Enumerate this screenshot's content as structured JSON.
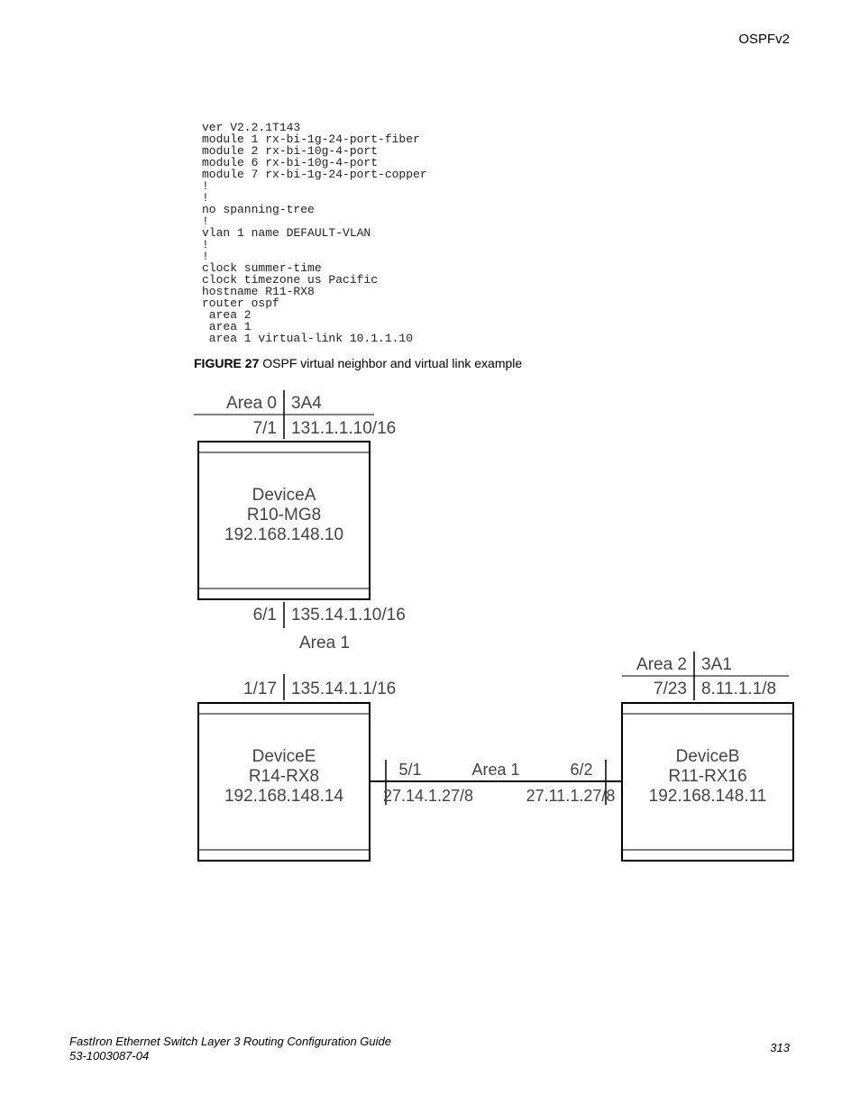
{
  "header": {
    "right": "OSPFv2"
  },
  "code": "ver V2.2.1T143\nmodule 1 rx-bi-1g-24-port-fiber\nmodule 2 rx-bi-10g-4-port\nmodule 6 rx-bi-10g-4-port\nmodule 7 rx-bi-1g-24-port-copper\n!\n!\nno spanning-tree\n!\nvlan 1 name DEFAULT-VLAN\n!\n!\nclock summer-time\nclock timezone us Pacific\nhostname R11-RX8\nrouter ospf\n area 2\n area 1\n area 1 virtual-link 10.1.1.10",
  "figure": {
    "label": "FIGURE 27",
    "caption": "OSPF virtual neighbor and virtual link example"
  },
  "diagram": {
    "deviceA": {
      "top_area": "Area 0",
      "top_id": "3A4",
      "top_port": "7/1",
      "top_ip": "131.1.1.10/16",
      "name_l1": "DeviceA",
      "name_l2": "R10-MG8",
      "name_l3": "192.168.148.10",
      "bot_port": "6/1",
      "bot_ip": "135.14.1.10/16",
      "bot_area": "Area 1"
    },
    "deviceE": {
      "top_port": "1/17",
      "top_ip": "135.14.1.1/16",
      "name_l1": "DeviceE",
      "name_l2": "R14-RX8",
      "name_l3": "192.168.148.14"
    },
    "link": {
      "left_port": "5/1",
      "area": "Area 1",
      "right_port": "6/2",
      "left_ip": "27.14.1.27/8",
      "right_ip": "27.11.1.27/8"
    },
    "deviceB": {
      "top_area": "Area 2",
      "top_id": "3A1",
      "top_port": "7/23",
      "top_ip": "8.11.1.1/8",
      "name_l1": "DeviceB",
      "name_l2": "R11-RX16",
      "name_l3": "192.168.148.11"
    }
  },
  "footer": {
    "title": "FastIron Ethernet Switch Layer 3 Routing Configuration Guide",
    "docnum": "53-1003087-04",
    "page": "313"
  }
}
